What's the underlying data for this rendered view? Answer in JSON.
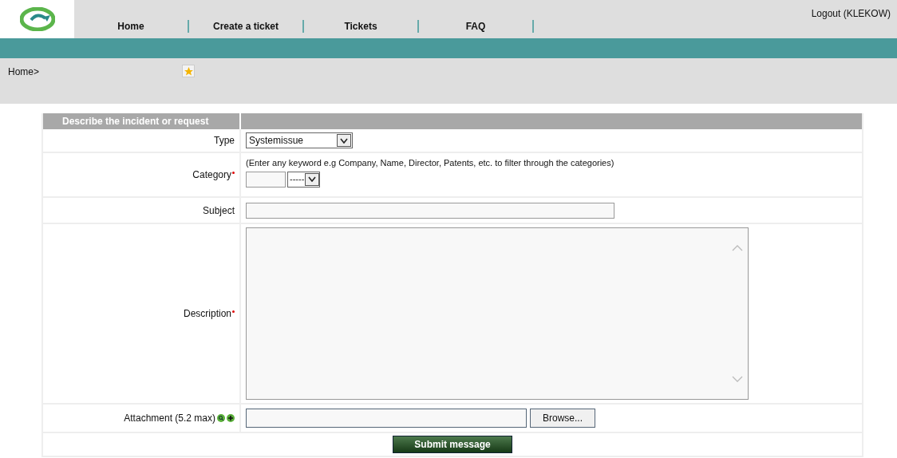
{
  "nav": {
    "items": [
      {
        "label": "Home"
      },
      {
        "label": "Create a ticket"
      },
      {
        "label": "Tickets"
      },
      {
        "label": "FAQ"
      }
    ],
    "logout": "Logout (KLEKOW)"
  },
  "breadcrumb": "Home>",
  "form": {
    "title": "Describe the incident or request",
    "type": {
      "label": "Type",
      "value": "Systemissue"
    },
    "category": {
      "label": "Category",
      "required": true,
      "hint": "(Enter any keyword e.g Company, Name, Director, Patents, etc. to filter through the categories)",
      "select_value": "-----"
    },
    "subject": {
      "label": "Subject"
    },
    "description": {
      "label": "Description",
      "required": true
    },
    "attachment": {
      "label": "Attachment (5.2 max)",
      "browse": "Browse..."
    },
    "submit": "Submit message"
  }
}
